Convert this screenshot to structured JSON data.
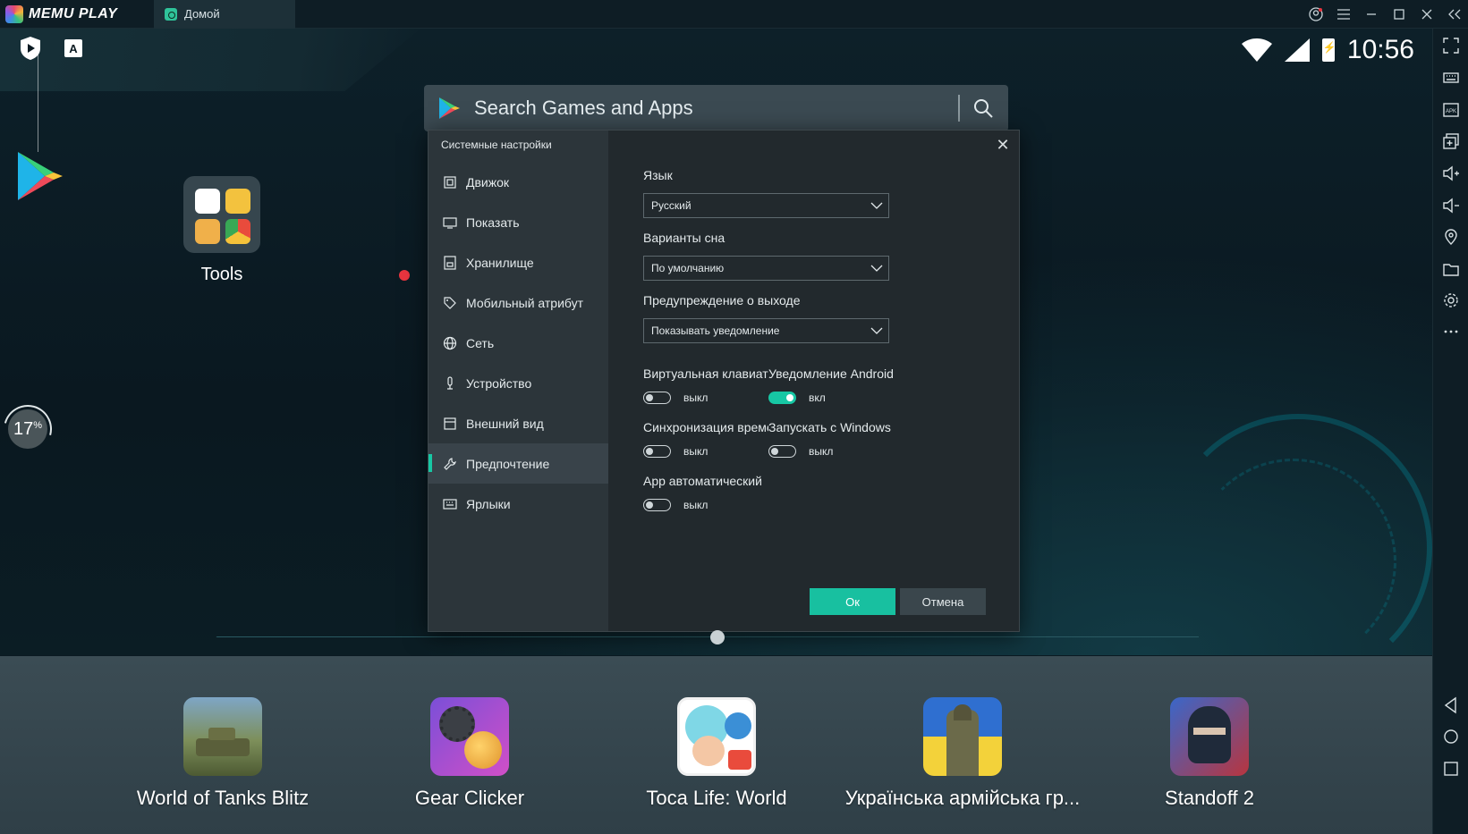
{
  "titlebar": {
    "app_name": "MEMU PLAY",
    "tab_label": "Домой",
    "controls": [
      "user-icon",
      "menu-icon",
      "minimize-icon",
      "maximize-icon",
      "close-icon",
      "collapse-icon"
    ]
  },
  "status": {
    "time": "10:56"
  },
  "desktop": {
    "tools_label": "Tools",
    "progress": {
      "value": "17",
      "unit": "%"
    }
  },
  "search": {
    "placeholder": "Search Games and Apps"
  },
  "dialog": {
    "title": "Системные настройки",
    "nav": [
      {
        "label": "Движок",
        "icon": "chip-icon"
      },
      {
        "label": "Показать",
        "icon": "monitor-icon"
      },
      {
        "label": "Хранилище",
        "icon": "storage-icon"
      },
      {
        "label": "Мобильный атрибут",
        "icon": "tag-icon"
      },
      {
        "label": "Сеть",
        "icon": "globe-icon"
      },
      {
        "label": "Устройство",
        "icon": "mic-icon"
      },
      {
        "label": "Внешний вид",
        "icon": "window-icon"
      },
      {
        "label": "Предпочтение",
        "icon": "wrench-icon",
        "active": true
      },
      {
        "label": "Ярлыки",
        "icon": "keyboard-icon"
      }
    ],
    "language": {
      "label": "Язык",
      "value": "Русский"
    },
    "sleep": {
      "label": "Варианты сна",
      "value": "По умолчанию"
    },
    "exit_warning": {
      "label": "Предупреждение о выходе",
      "value": "Показывать уведомление"
    },
    "virtual_keyboard": {
      "label": "Виртуальная клавиат",
      "state": "выкл",
      "on": false
    },
    "android_notify": {
      "label": "Уведомление Android",
      "state": "вкл",
      "on": true
    },
    "time_sync": {
      "label": "Синхронизация време",
      "state": "выкл",
      "on": false
    },
    "windows_start": {
      "label": "Запускать с Windows",
      "state": "выкл",
      "on": false
    },
    "app_auto": {
      "label": "App автоматический",
      "state": "выкл",
      "on": false
    },
    "ok_label": "Ок",
    "cancel_label": "Отмена"
  },
  "dock": {
    "apps": [
      {
        "label": "World of Tanks Blitz"
      },
      {
        "label": "Gear Clicker"
      },
      {
        "label": "Toca Life: World"
      },
      {
        "label": "Українська армійська гр..."
      },
      {
        "label": "Standoff 2"
      }
    ]
  },
  "colors": {
    "accent": "#18c0a0",
    "panel": "#22292d",
    "sidebar": "#2c353a"
  }
}
